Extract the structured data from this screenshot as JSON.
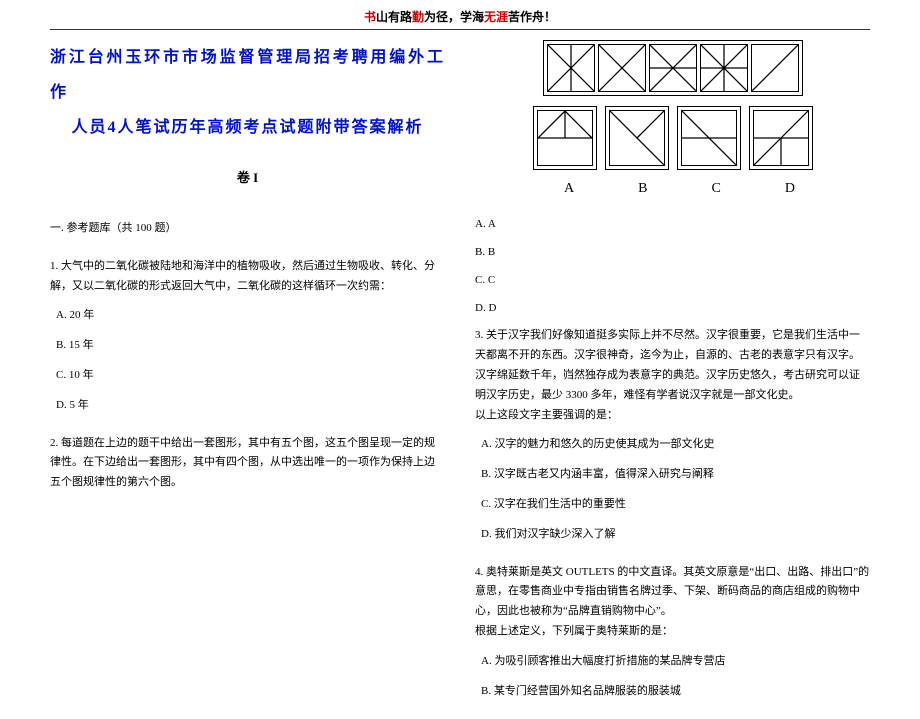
{
  "header": {
    "motto_parts": [
      {
        "text": "书",
        "cls": "red"
      },
      {
        "text": "山有路",
        "cls": "black"
      },
      {
        "text": "勤",
        "cls": "red"
      },
      {
        "text": "为径，学海",
        "cls": "black"
      },
      {
        "text": "无涯",
        "cls": "red"
      },
      {
        "text": "苦作舟！",
        "cls": "black"
      }
    ]
  },
  "exam_title_line1": "浙江台州玉环市市场监督管理局招考聘用编外工作",
  "exam_title_line2": "人员4人笔试历年高频考点试题附带答案解析",
  "volume": "卷 I",
  "section": "一. 参考题库（共 100 题）",
  "q1": {
    "stem": "1. 大气中的二氧化碳被陆地和海洋中的植物吸收，然后通过生物吸收、转化、分解，又以二氧化碳的形式返回大气中，二氧化碳的这样循环一次约需：",
    "a": "A. 20 年",
    "b": "B. 15 年",
    "c": "C. 10 年",
    "d": "D. 5 年"
  },
  "q2": {
    "stem": "2. 每道题在上边的题干中给出一套图形，其中有五个图，这五个图呈现一定的规律性。在下边给出一套图形，其中有四个图，从中选出唯一的一项作为保持上边五个图规律性的第六个图。"
  },
  "answer_labels": {
    "a": "A",
    "b": "B",
    "c": "C",
    "d": "D"
  },
  "opts_q2": {
    "aa": "A. A",
    "bb": "B. B",
    "cc": "C. C",
    "dd": "D. D"
  },
  "q3": {
    "stem": "3. 关于汉字我们好像知道挺多实际上并不尽然。汉字很重要，它是我们生活中一天都离不开的东西。汉字很神奇，迄今为止，自源的、古老的表意字只有汉字。汉字绵延数千年，岿然独存成为表意字的典范。汉字历史悠久，考古研究可以证明汉字历史，最少 3300 多年，难怪有学者说汉字就是一部文化史。",
    "prompt": "以上这段文字主要强调的是：",
    "a": "A. 汉字的魅力和悠久的历史使其成为一部文化史",
    "b": "B. 汉字既古老又内涵丰富，值得深入研究与阐释",
    "c": "C. 汉字在我们生活中的重要性",
    "d": "D. 我们对汉字缺少深入了解"
  },
  "q4": {
    "stem": "4. 奥特莱斯是英文 OUTLETS 的中文直译。其英文原意是“出口、出路、排出口”的意思，在零售商业中专指由销售名牌过季、下架、断码商品的商店组成的购物中心，因此也被称为“品牌直销购物中心”。",
    "prompt": "根据上述定义，下列属于奥特莱斯的是：",
    "a": "A. 为吸引顾客推出大幅度打折措施的某品牌专营店",
    "b": "B. 某专门经营国外知名品牌服装的服装城"
  }
}
